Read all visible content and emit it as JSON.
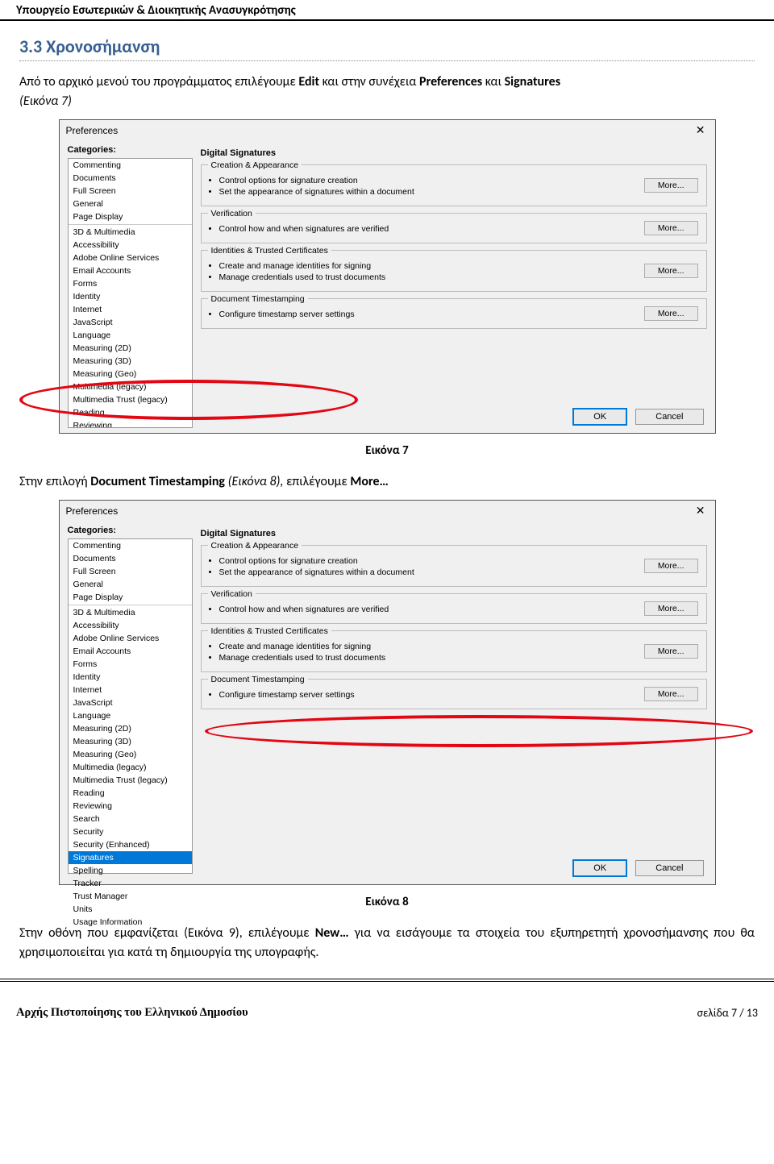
{
  "page_header": "Υπουργείο Εσωτερικών & Διοικητικής Ανασυγκρότησης",
  "section_title": "3.3 Χρονοσήμανση",
  "para1_pre": "Από το αρχικό μενού του προγράμματος επιλέγουμε ",
  "para1_edit": "Edit",
  "para1_mid": " και στην συνέχεια ",
  "para1_pref": "Preferences",
  "para1_and": " και ",
  "para1_sig": "Signatures",
  "para1_post_label": "(Εικόνα 7)",
  "caption7": "Εικόνα 7",
  "para2_pre": "Στην επιλογή ",
  "para2_dt": "Document Timestamping",
  "para2_mid": " (Εικόνα 8), ",
  "para2_sel": "επιλέγουμε ",
  "para2_more": "More…",
  "caption8": "Εικόνα 8",
  "para3_pre": "Στην οθόνη που εμφανίζεται (Εικόνα 9), επιλέγουμε ",
  "para3_new": "New…",
  "para3_post": " για να εισάγουμε τα στοιχεία του εξυπηρετητή χρονοσήμανσης που θα χρησιμοποιείται για κατά τη δημιουργία της υπογραφής.",
  "footer_left": "Αρχής Πιστοποίησης του Ελληνικού Δημοσίου",
  "footer_right": "σελίδα 7 / 13",
  "prefs": {
    "title": "Preferences",
    "cat_label": "Categories:",
    "panel_heading": "Digital Signatures",
    "categories_g1": [
      "Commenting",
      "Documents",
      "Full Screen",
      "General",
      "Page Display"
    ],
    "categories_g2": [
      "3D & Multimedia",
      "Accessibility",
      "Adobe Online Services",
      "Email Accounts",
      "Forms",
      "Identity",
      "Internet",
      "JavaScript",
      "Language",
      "Measuring (2D)",
      "Measuring (3D)",
      "Measuring (Geo)",
      "Multimedia (legacy)",
      "Multimedia Trust (legacy)",
      "Reading",
      "Reviewing",
      "Search",
      "Security",
      "Security (Enhanced)",
      "Signatures",
      "Spelling",
      "Tracker",
      "Trust Manager",
      "Units",
      "Usage Information"
    ],
    "categories_g2_short": [
      "3D & Multimedia",
      "Accessibility",
      "Adobe Online Services",
      "Email Accounts",
      "Forms",
      "Identity",
      "Internet",
      "JavaScript",
      "Language",
      "Measuring (2D)",
      "Measuring (3D)",
      "Measuring (Geo)",
      "Multimedia (legacy)",
      "Multimedia Trust (legacy)",
      "Reading",
      "Reviewing",
      "Search",
      "Security",
      "Security (Enhanced)",
      "Signatures",
      "Spelling",
      "Tracker",
      "Trust Manager",
      "Units",
      "Usage Information"
    ],
    "selected": "Signatures",
    "groups": [
      {
        "title": "Creation & Appearance",
        "bullets": [
          "Control options for signature creation",
          "Set the appearance of signatures within a document"
        ]
      },
      {
        "title": "Verification",
        "bullets": [
          "Control how and when signatures are verified"
        ]
      },
      {
        "title": "Identities & Trusted Certificates",
        "bullets": [
          "Create and manage identities for signing",
          "Manage credentials used to trust documents"
        ]
      },
      {
        "title": "Document Timestamping",
        "bullets": [
          "Configure timestamp server settings"
        ]
      }
    ],
    "more": "More...",
    "ok": "OK",
    "cancel": "Cancel"
  }
}
